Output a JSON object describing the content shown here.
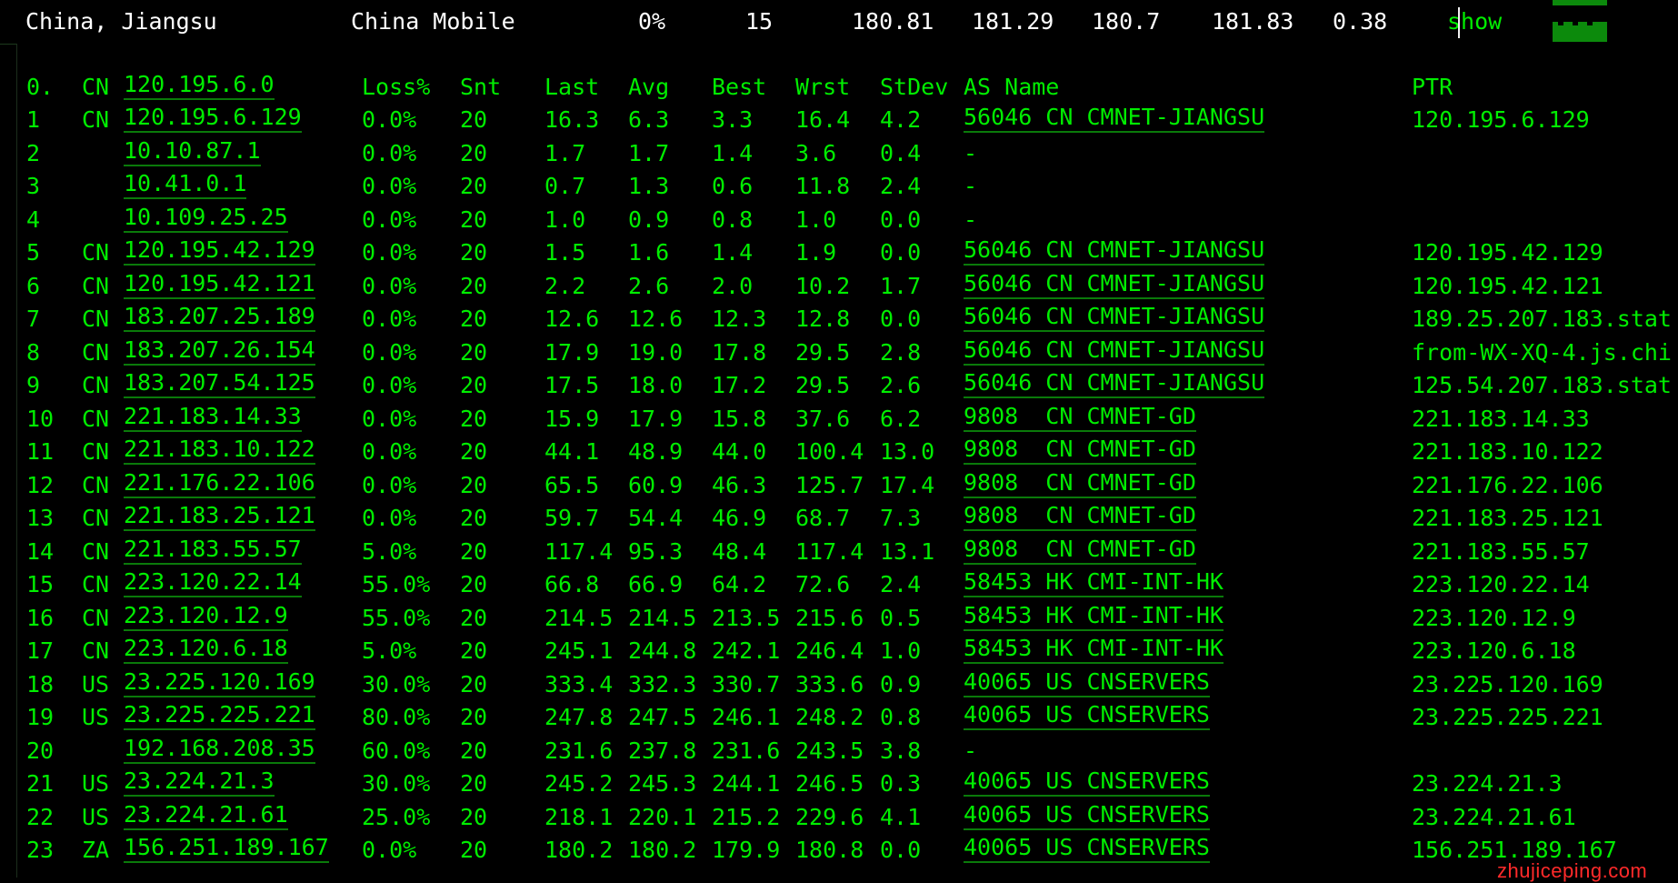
{
  "header": {
    "location": "China, Jiangsu",
    "isp": "China Mobile",
    "loss": "0%",
    "sent": "15",
    "last": "180.81",
    "avg": "181.29",
    "best": "180.7",
    "worst": "181.83",
    "stdev": "0.38",
    "show_label": "show"
  },
  "columns": {
    "hop": "0.",
    "cc": "CN",
    "host": "120.195.6.0",
    "loss": "Loss%",
    "snt": "Snt",
    "last": "Last",
    "avg": "Avg",
    "best": "Best",
    "wrst": "Wrst",
    "stdev": "StDev",
    "as_name": "AS Name",
    "ptr": "PTR"
  },
  "hops": [
    {
      "hop": "1",
      "cc": "CN",
      "host": "120.195.6.129",
      "loss": "0.0%",
      "snt": "20",
      "last": "16.3",
      "avg": "6.3",
      "best": "3.3",
      "wrst": "16.4",
      "stdev": "4.2",
      "as_name": "56046 CN CMNET-JIANGSU",
      "ptr": "120.195.6.129"
    },
    {
      "hop": "2",
      "cc": "",
      "host": "10.10.87.1",
      "loss": "0.0%",
      "snt": "20",
      "last": "1.7",
      "avg": "1.7",
      "best": "1.4",
      "wrst": "3.6",
      "stdev": "0.4",
      "as_name": "-",
      "ptr": ""
    },
    {
      "hop": "3",
      "cc": "",
      "host": "10.41.0.1",
      "loss": "0.0%",
      "snt": "20",
      "last": "0.7",
      "avg": "1.3",
      "best": "0.6",
      "wrst": "11.8",
      "stdev": "2.4",
      "as_name": "-",
      "ptr": ""
    },
    {
      "hop": "4",
      "cc": "",
      "host": "10.109.25.25",
      "loss": "0.0%",
      "snt": "20",
      "last": "1.0",
      "avg": "0.9",
      "best": "0.8",
      "wrst": "1.0",
      "stdev": "0.0",
      "as_name": "-",
      "ptr": ""
    },
    {
      "hop": "5",
      "cc": "CN",
      "host": "120.195.42.129",
      "loss": "0.0%",
      "snt": "20",
      "last": "1.5",
      "avg": "1.6",
      "best": "1.4",
      "wrst": "1.9",
      "stdev": "0.0",
      "as_name": "56046 CN CMNET-JIANGSU",
      "ptr": "120.195.42.129"
    },
    {
      "hop": "6",
      "cc": "CN",
      "host": "120.195.42.121",
      "loss": "0.0%",
      "snt": "20",
      "last": "2.2",
      "avg": "2.6",
      "best": "2.0",
      "wrst": "10.2",
      "stdev": "1.7",
      "as_name": "56046 CN CMNET-JIANGSU",
      "ptr": "120.195.42.121"
    },
    {
      "hop": "7",
      "cc": "CN",
      "host": "183.207.25.189",
      "loss": "0.0%",
      "snt": "20",
      "last": "12.6",
      "avg": "12.6",
      "best": "12.3",
      "wrst": "12.8",
      "stdev": "0.0",
      "as_name": "56046 CN CMNET-JIANGSU",
      "ptr": "189.25.207.183.stat"
    },
    {
      "hop": "8",
      "cc": "CN",
      "host": "183.207.26.154",
      "loss": "0.0%",
      "snt": "20",
      "last": "17.9",
      "avg": "19.0",
      "best": "17.8",
      "wrst": "29.5",
      "stdev": "2.8",
      "as_name": "56046 CN CMNET-JIANGSU",
      "ptr": "from-WX-XQ-4.js.chi"
    },
    {
      "hop": "9",
      "cc": "CN",
      "host": "183.207.54.125",
      "loss": "0.0%",
      "snt": "20",
      "last": "17.5",
      "avg": "18.0",
      "best": "17.2",
      "wrst": "29.5",
      "stdev": "2.6",
      "as_name": "56046 CN CMNET-JIANGSU",
      "ptr": "125.54.207.183.stat"
    },
    {
      "hop": "10",
      "cc": "CN",
      "host": "221.183.14.33",
      "loss": "0.0%",
      "snt": "20",
      "last": "15.9",
      "avg": "17.9",
      "best": "15.8",
      "wrst": "37.6",
      "stdev": "6.2",
      "as_name": "9808  CN CMNET-GD",
      "ptr": "221.183.14.33"
    },
    {
      "hop": "11",
      "cc": "CN",
      "host": "221.183.10.122",
      "loss": "0.0%",
      "snt": "20",
      "last": "44.1",
      "avg": "48.9",
      "best": "44.0",
      "wrst": "100.4",
      "stdev": "13.0",
      "as_name": "9808  CN CMNET-GD",
      "ptr": "221.183.10.122"
    },
    {
      "hop": "12",
      "cc": "CN",
      "host": "221.176.22.106",
      "loss": "0.0%",
      "snt": "20",
      "last": "65.5",
      "avg": "60.9",
      "best": "46.3",
      "wrst": "125.7",
      "stdev": "17.4",
      "as_name": "9808  CN CMNET-GD",
      "ptr": "221.176.22.106"
    },
    {
      "hop": "13",
      "cc": "CN",
      "host": "221.183.25.121",
      "loss": "0.0%",
      "snt": "20",
      "last": "59.7",
      "avg": "54.4",
      "best": "46.9",
      "wrst": "68.7",
      "stdev": "7.3",
      "as_name": "9808  CN CMNET-GD",
      "ptr": "221.183.25.121"
    },
    {
      "hop": "14",
      "cc": "CN",
      "host": "221.183.55.57",
      "loss": "5.0%",
      "snt": "20",
      "last": "117.4",
      "avg": "95.3",
      "best": "48.4",
      "wrst": "117.4",
      "stdev": "13.1",
      "as_name": "9808  CN CMNET-GD",
      "ptr": "221.183.55.57"
    },
    {
      "hop": "15",
      "cc": "CN",
      "host": "223.120.22.14",
      "loss": "55.0%",
      "snt": "20",
      "last": "66.8",
      "avg": "66.9",
      "best": "64.2",
      "wrst": "72.6",
      "stdev": "2.4",
      "as_name": "58453 HK CMI-INT-HK",
      "ptr": "223.120.22.14"
    },
    {
      "hop": "16",
      "cc": "CN",
      "host": "223.120.12.9",
      "loss": "55.0%",
      "snt": "20",
      "last": "214.5",
      "avg": "214.5",
      "best": "213.5",
      "wrst": "215.6",
      "stdev": "0.5",
      "as_name": "58453 HK CMI-INT-HK",
      "ptr": "223.120.12.9"
    },
    {
      "hop": "17",
      "cc": "CN",
      "host": "223.120.6.18",
      "loss": "5.0%",
      "snt": "20",
      "last": "245.1",
      "avg": "244.8",
      "best": "242.1",
      "wrst": "246.4",
      "stdev": "1.0",
      "as_name": "58453 HK CMI-INT-HK",
      "ptr": "223.120.6.18"
    },
    {
      "hop": "18",
      "cc": "US",
      "host": "23.225.120.169",
      "loss": "30.0%",
      "snt": "20",
      "last": "333.4",
      "avg": "332.3",
      "best": "330.7",
      "wrst": "333.6",
      "stdev": "0.9",
      "as_name": "40065 US CNSERVERS",
      "ptr": "23.225.120.169"
    },
    {
      "hop": "19",
      "cc": "US",
      "host": "23.225.225.221",
      "loss": "80.0%",
      "snt": "20",
      "last": "247.8",
      "avg": "247.5",
      "best": "246.1",
      "wrst": "248.2",
      "stdev": "0.8",
      "as_name": "40065 US CNSERVERS",
      "ptr": "23.225.225.221"
    },
    {
      "hop": "20",
      "cc": "",
      "host": "192.168.208.35",
      "loss": "60.0%",
      "snt": "20",
      "last": "231.6",
      "avg": "237.8",
      "best": "231.6",
      "wrst": "243.5",
      "stdev": "3.8",
      "as_name": "-",
      "ptr": ""
    },
    {
      "hop": "21",
      "cc": "US",
      "host": "23.224.21.3",
      "loss": "30.0%",
      "snt": "20",
      "last": "245.2",
      "avg": "245.3",
      "best": "244.1",
      "wrst": "246.5",
      "stdev": "0.3",
      "as_name": "40065 US CNSERVERS",
      "ptr": "23.224.21.3"
    },
    {
      "hop": "22",
      "cc": "US",
      "host": "23.224.21.61",
      "loss": "25.0%",
      "snt": "20",
      "last": "218.1",
      "avg": "220.1",
      "best": "215.2",
      "wrst": "229.6",
      "stdev": "4.1",
      "as_name": "40065 US CNSERVERS",
      "ptr": "23.224.21.61"
    },
    {
      "hop": "23",
      "cc": "ZA",
      "host": "156.251.189.167",
      "loss": "0.0%",
      "snt": "20",
      "last": "180.2",
      "avg": "180.2",
      "best": "179.9",
      "wrst": "180.8",
      "stdev": "0.0",
      "as_name": "40065 US CNSERVERS",
      "ptr": "156.251.189.167"
    }
  ],
  "watermark": "zhujiceping.com",
  "colors": {
    "text_green": "#00ee00",
    "header_white": "#ffffff",
    "graph_green": "#0c8a0c",
    "watermark_red": "#ff2a2a"
  }
}
